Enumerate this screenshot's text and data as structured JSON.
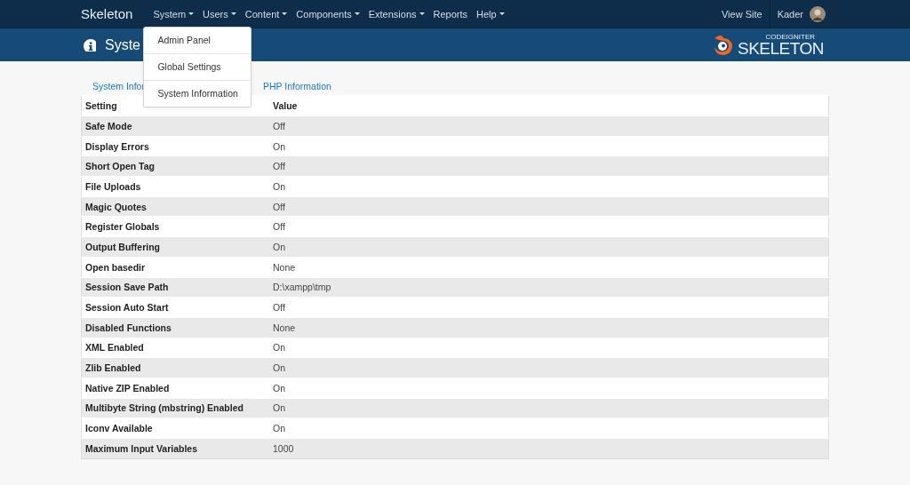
{
  "navbar": {
    "brand": "Skeleton",
    "items": [
      {
        "label": "System",
        "kind": "dropdown"
      },
      {
        "label": "Users",
        "kind": "dropdown"
      },
      {
        "label": "Content",
        "kind": "dropdown"
      },
      {
        "label": "Components",
        "kind": "dropdown"
      },
      {
        "label": "Extensions",
        "kind": "dropdown"
      },
      {
        "label": "Reports",
        "kind": "link"
      },
      {
        "label": "Help",
        "kind": "dropdown"
      }
    ],
    "right": {
      "view_site": "View Site",
      "user": "Kader"
    }
  },
  "dropdown_menu": {
    "items": [
      "Admin Panel",
      "Global Settings",
      "System Information"
    ]
  },
  "header": {
    "title": "Syste",
    "logo": {
      "small": "CODEIGNITER",
      "text": "SKELETON"
    }
  },
  "tabs": [
    {
      "label": "System Infor"
    },
    {
      "label": "PHP Information"
    }
  ],
  "table": {
    "columns": [
      "Setting",
      "Value"
    ],
    "rows": [
      [
        "Safe Mode",
        "Off"
      ],
      [
        "Display Errors",
        "On"
      ],
      [
        "Short Open Tag",
        "Off"
      ],
      [
        "File Uploads",
        "On"
      ],
      [
        "Magic Quotes",
        "Off"
      ],
      [
        "Register Globals",
        "Off"
      ],
      [
        "Output Buffering",
        "On"
      ],
      [
        "Open basedir",
        "None"
      ],
      [
        "Session Save Path",
        "D:\\xampp\\tmp"
      ],
      [
        "Session Auto Start",
        "Off"
      ],
      [
        "Disabled Functions",
        "None"
      ],
      [
        "XML Enabled",
        "On"
      ],
      [
        "Zlib Enabled",
        "On"
      ],
      [
        "Native ZIP Enabled",
        "On"
      ],
      [
        "Multibyte String (mbstring) Enabled",
        "On"
      ],
      [
        "Iconv Available",
        "On"
      ],
      [
        "Maximum Input Variables",
        "1000"
      ]
    ]
  }
}
